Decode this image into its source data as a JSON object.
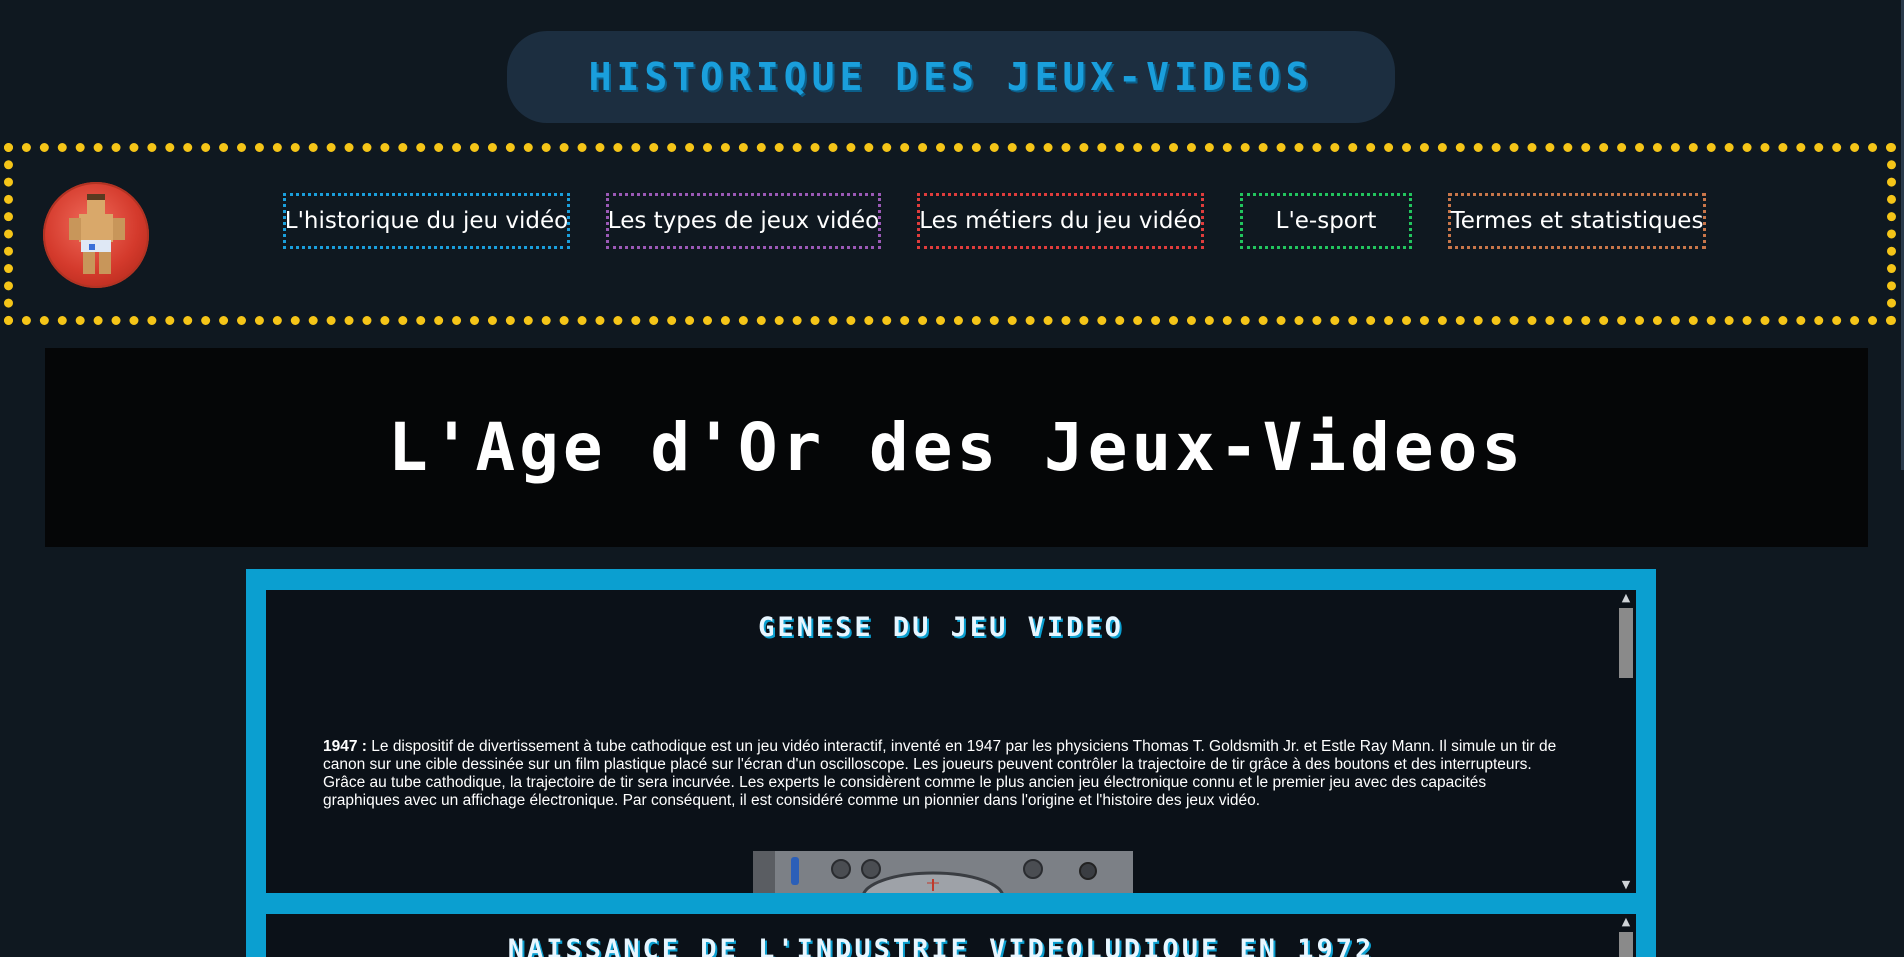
{
  "header": {
    "site_title": "HISTORIQUE DES JEUX-VIDEOS"
  },
  "nav": {
    "logo_icon": "pixel-fighter-logo-icon",
    "links": [
      {
        "label": "L'historique du jeu vidéo",
        "color": "#1a9fdc"
      },
      {
        "label": "Les types de jeux vidéo",
        "color": "#9b59b6"
      },
      {
        "label": "Les métiers du jeu vidéo",
        "color": "#e03c3c"
      },
      {
        "label": "L'e-sport",
        "color": "#22c55e"
      },
      {
        "label": "Termes et statistiques",
        "color": "#c8764a"
      }
    ],
    "border_color": "#f5c518"
  },
  "banner": {
    "text": "L'Age d'Or des Jeux-Videos"
  },
  "sections": [
    {
      "title": "GENESE DU JEU VIDEO",
      "year": "1947 :",
      "text": "Le dispositif de divertissement à tube cathodique est un jeu vidéo interactif, inventé en 1947 par les physiciens Thomas T. Goldsmith Jr. et Estle Ray Mann. Il simule un tir de canon sur une cible dessinée sur un film plastique placé sur l'écran d'un oscilloscope. Les joueurs peuvent contrôler la trajectoire de tir grâce à des boutons et des interrupteurs. Grâce au tube cathodique, la trajectoire de tir sera incurvée. Les experts le considèrent comme le plus ancien jeu électronique connu et le premier jeu avec des capacités graphiques avec un affichage électronique. Par conséquent, il est considéré comme un pionnier dans l'origine et l'histoire des jeux vidéo.",
      "image_icon": "cathode-ray-tube-device-photo"
    },
    {
      "title": "NAISSANCE DE L'INDUSTRIE VIDEOLUDIQUE EN 1972"
    }
  ],
  "colors": {
    "background": "#0f1820",
    "accent": "#0b9fd0",
    "title_blue": "#1a9fdc"
  }
}
